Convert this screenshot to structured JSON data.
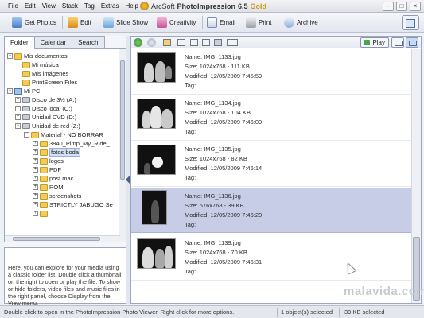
{
  "app": {
    "title_prefix": "ArcSoft",
    "title_name": "PhotoImpression",
    "title_version": "6.5",
    "title_edition": "Gold"
  },
  "menu": [
    "File",
    "Edit",
    "View",
    "Stack",
    "Tag",
    "Extras",
    "Help"
  ],
  "toolbar": {
    "get_photos": "Get Photos",
    "edit": "Edit",
    "slide_show": "Slide Show",
    "creativity": "Creativity",
    "email": "Email",
    "print": "Print",
    "archive": "Archive"
  },
  "left_panel": {
    "tabs": [
      "Folder",
      "Calendar",
      "Search"
    ],
    "tree": [
      "Mis documentos",
      "Mi música",
      "Mis imágenes",
      "PrintScreen Files",
      "Mi PC",
      "Disco de 3½ (A:)",
      "Disco local (C:)",
      "Unidad DVD (D:)",
      "Unidad de red (Z:)",
      "Material - NO BORRAR",
      "3840_Pimp_My_Ride_",
      "fotos boda",
      "logos",
      "PDF",
      "post mac",
      "ROM",
      "screenshots",
      "STRICTLY JABUGO Se"
    ],
    "help_text": "Here, you can explore for your media using a classic folder list. Double click a thumbnail on the right to open or play the file. To show or hide folders, video files and music files in the right panel, choose Display from the View menu."
  },
  "right_toolbar": {
    "play_label": "Play"
  },
  "files": {
    "labels": {
      "name": "Name:",
      "size": "Size:",
      "modified": "Modified:",
      "tag": "Tag:"
    },
    "items": [
      {
        "name": "IMG_1133.jpg",
        "size": "1024x768 - 111 KB",
        "modified": "12/05/2009 7:45:59",
        "tag": ""
      },
      {
        "name": "IMG_1134.jpg",
        "size": "1024x768 - 104 KB",
        "modified": "12/05/2009 7:46:09",
        "tag": ""
      },
      {
        "name": "IMG_1135.jpg",
        "size": "1024x768 - 82 KB",
        "modified": "12/05/2009 7:46:14",
        "tag": ""
      },
      {
        "name": "IMG_1136.jpg",
        "size": "576x768 - 39 KB",
        "modified": "12/05/2009 7:46:20",
        "tag": ""
      },
      {
        "name": "IMG_1139.jpg",
        "size": "1024x768 - 70 KB",
        "modified": "12/05/2009 7:46:31",
        "tag": ""
      }
    ]
  },
  "watermark": "malavida.com",
  "status": {
    "hint": "Double click to open in the PhotoImpression Photo Viewer. Right click for more options.",
    "selected": "1 object(s) selected",
    "size": "39 KB selected"
  },
  "colors": {
    "selection": "#c7cde7",
    "folder": "#f2cc54",
    "accent_gold": "#c99a10"
  }
}
